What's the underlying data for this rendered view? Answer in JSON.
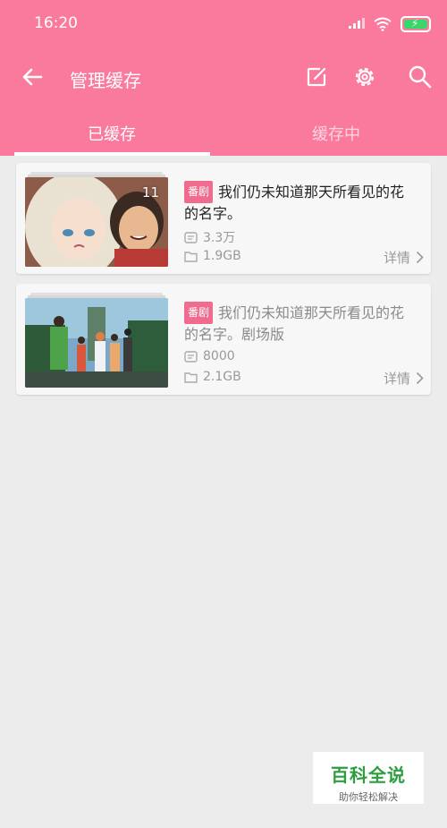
{
  "status_bar": {
    "time": "16:20"
  },
  "appbar": {
    "title": "管理缓存"
  },
  "tabs": [
    {
      "label": "已缓存",
      "active": true
    },
    {
      "label": "缓存中",
      "active": false
    }
  ],
  "items": [
    {
      "tag": "番剧",
      "title": "我们仍未知道那天所看见的花的名字。",
      "episodes": "11",
      "views": "3.3万",
      "size": "1.9GB",
      "detail_label": "详情",
      "title_dim": false
    },
    {
      "tag": "番剧",
      "title": "我们仍未知道那天所看见的花的名字。剧场版",
      "episodes": "",
      "views": "8000",
      "size": "2.1GB",
      "detail_label": "详情",
      "title_dim": true
    }
  ],
  "watermark": {
    "title": "百科全说",
    "subtitle": "助你轻松解决"
  },
  "colors": {
    "primary": "#f97a9c",
    "tag": "#f06b8e",
    "background": "#ececec"
  }
}
